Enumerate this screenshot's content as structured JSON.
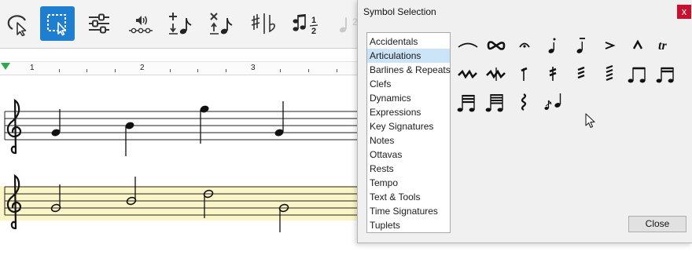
{
  "dialog": {
    "title": "Symbol Selection",
    "close_glyph": "x",
    "close_button_label": "Close",
    "categories": [
      {
        "label": "Accidentals",
        "selected": false
      },
      {
        "label": "Articulations",
        "selected": true
      },
      {
        "label": "Barlines & Repeats",
        "selected": false
      },
      {
        "label": "Clefs",
        "selected": false
      },
      {
        "label": "Dynamics",
        "selected": false
      },
      {
        "label": "Expressions",
        "selected": false
      },
      {
        "label": "Key Signatures",
        "selected": false
      },
      {
        "label": "Notes",
        "selected": false
      },
      {
        "label": "Ottavas",
        "selected": false
      },
      {
        "label": "Rests",
        "selected": false
      },
      {
        "label": "Tempo",
        "selected": false
      },
      {
        "label": "Text & Tools",
        "selected": false
      },
      {
        "label": "Time Signatures",
        "selected": false
      },
      {
        "label": "Tuplets",
        "selected": false
      }
    ],
    "symbols": [
      {
        "icon": "slur-icon"
      },
      {
        "icon": "turn-icon"
      },
      {
        "icon": "fermata-icon"
      },
      {
        "icon": "staccato-icon"
      },
      {
        "icon": "tenuto-icon"
      },
      {
        "icon": "accent-icon"
      },
      {
        "icon": "marcato-icon"
      },
      {
        "text": "tr",
        "icon": "trill-icon"
      },
      {
        "icon": "mordent-icon"
      },
      {
        "icon": "inverted-mordent-icon"
      },
      {
        "icon": "tremolo-1-icon"
      },
      {
        "icon": "tremolo-2-icon"
      },
      {
        "icon": "tremolo-3-icon"
      },
      {
        "icon": "tremolo-4-icon"
      },
      {
        "icon": "beamed-eighths-icon"
      },
      {
        "icon": "beamed-sixteenths-icon"
      },
      {
        "icon": "beamed-32nds-icon"
      },
      {
        "icon": "beamed-64ths-icon"
      },
      {
        "icon": "arpeggio-icon"
      },
      {
        "icon": "grace-note-icon"
      }
    ]
  },
  "toolbar": {
    "tools": [
      {
        "icon": "lasso-select-icon",
        "active": false
      },
      {
        "icon": "marquee-select-icon",
        "active": true
      },
      {
        "icon": "mixer-sliders-icon",
        "active": false
      },
      {
        "icon": "audio-playback-icon",
        "active": false
      },
      {
        "icon": "add-note-icon",
        "active": false
      },
      {
        "icon": "delete-note-icon",
        "active": false
      },
      {
        "icon": "accidentals-icon",
        "active": false
      },
      {
        "icon": "tuplet-icon",
        "active": false
      },
      {
        "icon": "note-duration-icon",
        "active": false
      }
    ],
    "tuplet_number_top": "1",
    "tuplet_number_bottom": "2",
    "clipped_number": "2"
  },
  "ruler": {
    "measure_numbers": [
      "1",
      "2",
      "3"
    ]
  },
  "score": {
    "staves": [
      {
        "clef": "treble-clef-icon",
        "highlighted": false
      },
      {
        "clef": "treble-clef-icon",
        "highlighted": true
      }
    ]
  }
}
